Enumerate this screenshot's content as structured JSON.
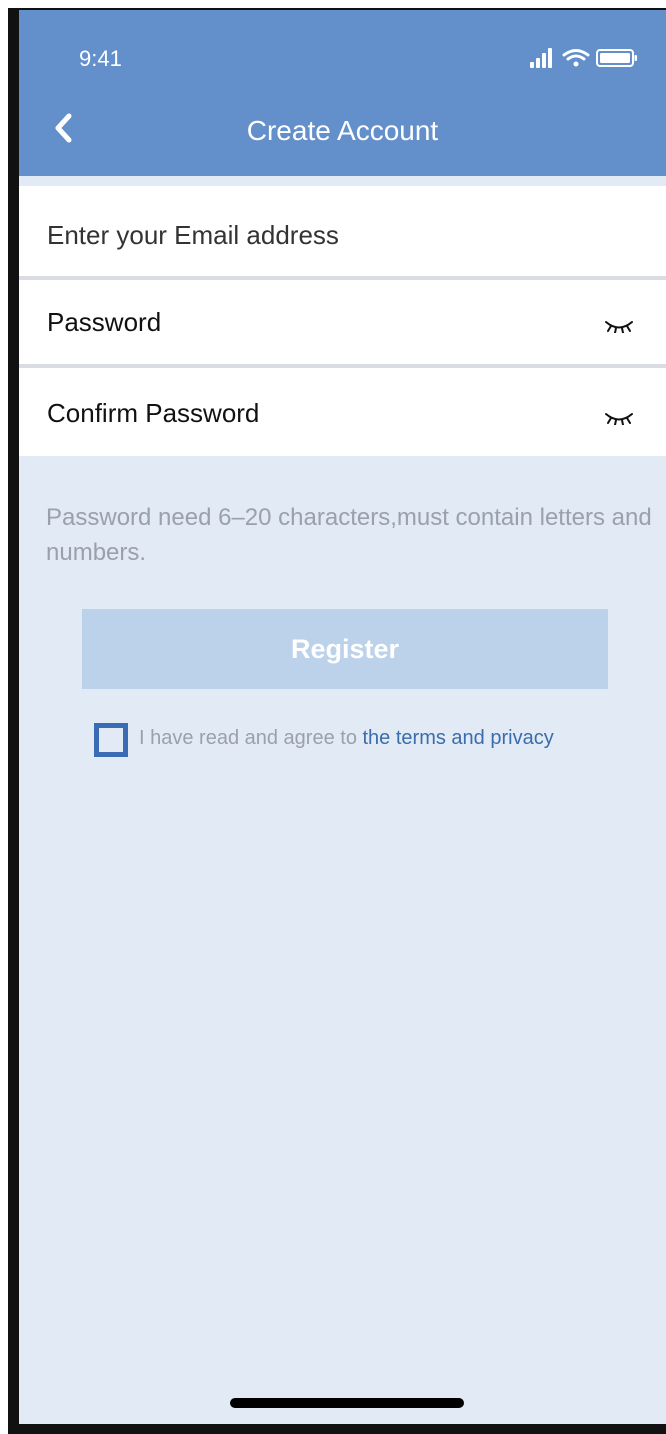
{
  "status_bar": {
    "time": "9:41",
    "icons": [
      "signal-icon",
      "wifi-icon",
      "battery-icon"
    ]
  },
  "header": {
    "title": "Create Account",
    "back_icon": "chevron-left-icon",
    "background": "#6390cb"
  },
  "form": {
    "email_placeholder": "Enter your Email address",
    "password_label": "Password",
    "confirm_password_label": "Confirm Password",
    "visibility_icon": "eye-closed-icon"
  },
  "hint": "Password need 6–20 characters,must contain letters and numbers.",
  "register_button": {
    "label": "Register",
    "color": "#bcd1ea"
  },
  "agreement": {
    "prefix": "I have read and agree to ",
    "link": "the terms and privacy",
    "checked": false,
    "link_color": "#3b6cab"
  }
}
